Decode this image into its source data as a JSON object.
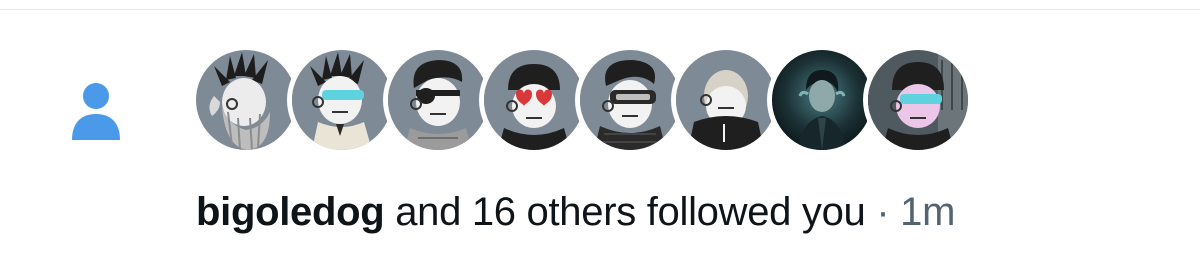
{
  "notification": {
    "type_icon": "person-icon",
    "accent_color": "#4b99e9",
    "username": "bigoledog",
    "action_text": " and 16 others followed you",
    "separator": " · ",
    "timestamp": "1m",
    "avatars": [
      {
        "label": "avatar-1",
        "style": "punk"
      },
      {
        "label": "avatar-2",
        "style": "punk-shades"
      },
      {
        "label": "avatar-3",
        "style": "pompadour-eyepatch"
      },
      {
        "label": "avatar-4",
        "style": "beanie-heart-glasses"
      },
      {
        "label": "avatar-5",
        "style": "pompadour-visor"
      },
      {
        "label": "avatar-6",
        "style": "bald-hoodie"
      },
      {
        "label": "avatar-7",
        "style": "photo-dark"
      },
      {
        "label": "avatar-8",
        "style": "beanie-shades"
      }
    ]
  }
}
